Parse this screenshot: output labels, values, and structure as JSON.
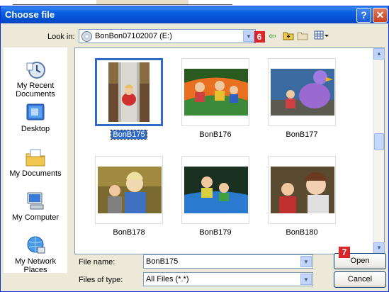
{
  "dialog": {
    "title": "Choose file"
  },
  "lookin": {
    "label": "Look in:",
    "value": "BonBon07102007 (E:)",
    "badge": "6"
  },
  "places": [
    {
      "label": "My Recent Documents"
    },
    {
      "label": "Desktop"
    },
    {
      "label": "My Documents"
    },
    {
      "label": "My Computer"
    },
    {
      "label": "My Network Places"
    }
  ],
  "files": [
    {
      "name": "BonB175",
      "selected": true
    },
    {
      "name": "BonB176",
      "selected": false
    },
    {
      "name": "BonB177",
      "selected": false
    },
    {
      "name": "BonB178",
      "selected": false
    },
    {
      "name": "BonB179",
      "selected": false
    },
    {
      "name": "BonB180",
      "selected": false
    }
  ],
  "filename": {
    "label": "File name:",
    "value": "BonB175"
  },
  "filetype": {
    "label": "Files of type:",
    "value": "All Files (*.*)"
  },
  "buttons": {
    "open": "Open",
    "cancel": "Cancel",
    "open_badge": "7"
  },
  "colors": {
    "titlebar": "#0551d6",
    "selection": "#316ac5",
    "badge": "#d8262a",
    "face": "#ece9d8"
  }
}
